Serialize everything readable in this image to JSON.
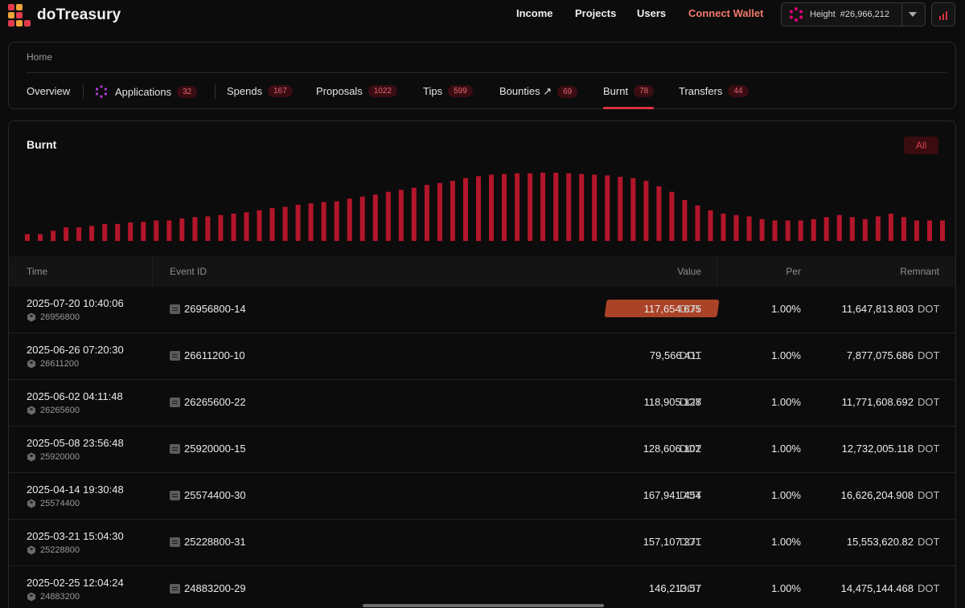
{
  "header": {
    "brand": "doTreasury",
    "nav": [
      "Income",
      "Projects",
      "Users"
    ],
    "connect_wallet": "Connect Wallet",
    "height_label": "Height",
    "height_value": "#26,966,212",
    "accent_color": "#d9333f"
  },
  "breadcrumb": "Home",
  "tabs": [
    {
      "label": "Overview",
      "count": ""
    },
    {
      "label": "Applications",
      "count": "32"
    },
    {
      "label": "Spends",
      "count": "167"
    },
    {
      "label": "Proposals",
      "count": "1022"
    },
    {
      "label": "Tips",
      "count": "599"
    },
    {
      "label": "Bounties ↗",
      "count": "69"
    },
    {
      "label": "Burnt",
      "count": "78",
      "active": true
    },
    {
      "label": "Transfers",
      "count": "44"
    }
  ],
  "section": {
    "title": "Burnt",
    "filter": "All"
  },
  "chart_data": {
    "type": "bar",
    "bar_color": "#b3162a",
    "values": [
      0.1,
      0.1,
      0.15,
      0.2,
      0.2,
      0.22,
      0.25,
      0.25,
      0.27,
      0.28,
      0.3,
      0.3,
      0.33,
      0.35,
      0.36,
      0.38,
      0.4,
      0.42,
      0.45,
      0.48,
      0.5,
      0.53,
      0.55,
      0.57,
      0.58,
      0.62,
      0.65,
      0.68,
      0.72,
      0.75,
      0.78,
      0.82,
      0.85,
      0.88,
      0.92,
      0.95,
      0.97,
      0.98,
      0.99,
      0.99,
      1.0,
      1.0,
      0.99,
      0.98,
      0.97,
      0.96,
      0.94,
      0.92,
      0.88,
      0.8,
      0.72,
      0.6,
      0.52,
      0.45,
      0.4,
      0.38,
      0.36,
      0.32,
      0.3,
      0.3,
      0.3,
      0.32,
      0.35,
      0.38,
      0.35,
      0.32,
      0.36,
      0.4,
      0.35,
      0.3,
      0.3,
      0.3
    ]
  },
  "table": {
    "headers": {
      "time": "Time",
      "event": "Event ID",
      "value": "Value",
      "per": "Per",
      "remnant": "Remnant"
    },
    "rows": [
      {
        "time": "2025-07-20 10:40:06",
        "block": "26956800",
        "event": "26956800-14",
        "value": "117,654.675",
        "unit": "DOT",
        "per": "1.00%",
        "remnant": "11,647,813.803",
        "runit": "DOT",
        "highlight": true
      },
      {
        "time": "2025-06-26 07:20:30",
        "block": "26611200",
        "event": "26611200-10",
        "value": "79,566.411",
        "unit": "DOT",
        "per": "1.00%",
        "remnant": "7,877,075.686",
        "runit": "DOT"
      },
      {
        "time": "2025-06-02 04:11:48",
        "block": "26265600",
        "event": "26265600-22",
        "value": "118,905.128",
        "unit": "DOT",
        "per": "1.00%",
        "remnant": "11,771,608.692",
        "runit": "DOT"
      },
      {
        "time": "2025-05-08 23:56:48",
        "block": "25920000",
        "event": "25920000-15",
        "value": "128,606.102",
        "unit": "DOT",
        "per": "1.00%",
        "remnant": "12,732,005.118",
        "runit": "DOT"
      },
      {
        "time": "2025-04-14 19:30:48",
        "block": "25574400",
        "event": "25574400-30",
        "value": "167,941.454",
        "unit": "DOT",
        "per": "1.00%",
        "remnant": "16,626,204.908",
        "runit": "DOT"
      },
      {
        "time": "2025-03-21 15:04:30",
        "block": "25228800",
        "event": "25228800-31",
        "value": "157,107.271",
        "unit": "DOT",
        "per": "1.00%",
        "remnant": "15,553,620.82",
        "runit": "DOT"
      },
      {
        "time": "2025-02-25 12:04:24",
        "block": "24883200",
        "event": "24883200-29",
        "value": "146,213.57",
        "unit": "DOT",
        "per": "1.00%",
        "remnant": "14,475,144.468",
        "runit": "DOT"
      }
    ]
  }
}
